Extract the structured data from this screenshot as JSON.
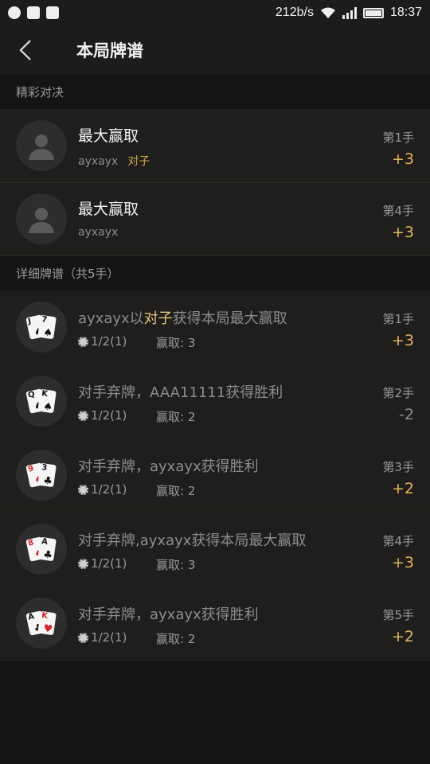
{
  "status_bar": {
    "speed": "212b/s",
    "time": "18:37"
  },
  "header": {
    "title": "本局牌谱"
  },
  "highlights": {
    "section_label": "精彩对决",
    "items": [
      {
        "title": "最大赢取",
        "player": "ayxayx",
        "hand_type": "对子",
        "hand_no": "第1手",
        "score": "+3"
      },
      {
        "title": "最大赢取",
        "player": "ayxayx",
        "hand_type": "",
        "hand_no": "第4手",
        "score": "+3"
      }
    ]
  },
  "details": {
    "section_label": "详细牌谱（共5手）",
    "items": [
      {
        "desc_a": "ayxayx以",
        "desc_hl": "对子",
        "desc_b": "获得本局最大赢取",
        "blinds": "1/2(1)",
        "win": "赢取: 3",
        "hand_no": "第1手",
        "score": "+3",
        "cards": [
          {
            "rank": "J",
            "suit": "♠",
            "red": false
          },
          {
            "rank": "7",
            "suit": "♠",
            "red": false
          }
        ]
      },
      {
        "desc_a": "对手弃牌，AAA11111获得胜利",
        "desc_hl": "",
        "desc_b": "",
        "blinds": "1/2(1)",
        "win": "赢取: 2",
        "hand_no": "第2手",
        "score": "-2",
        "cards": [
          {
            "rank": "Q",
            "suit": "♠",
            "red": false
          },
          {
            "rank": "K",
            "suit": "♠",
            "red": false
          }
        ]
      },
      {
        "desc_a": "对手弃牌，ayxayx获得胜利",
        "desc_hl": "",
        "desc_b": "",
        "blinds": "1/2(1)",
        "win": "赢取: 2",
        "hand_no": "第3手",
        "score": "+2",
        "cards": [
          {
            "rank": "9",
            "suit": "♦",
            "red": true
          },
          {
            "rank": "3",
            "suit": "♣",
            "red": false
          }
        ]
      },
      {
        "desc_a": "对手弃牌,ayxayx获得本局最大赢取",
        "desc_hl": "",
        "desc_b": "",
        "blinds": "1/2(1)",
        "win": "赢取: 3",
        "hand_no": "第4手",
        "score": "+3",
        "cards": [
          {
            "rank": "8",
            "suit": "♦",
            "red": true
          },
          {
            "rank": "A",
            "suit": "♣",
            "red": false
          }
        ]
      },
      {
        "desc_a": "对手弃牌，ayxayx获得胜利",
        "desc_hl": "",
        "desc_b": "",
        "blinds": "1/2(1)",
        "win": "赢取: 2",
        "hand_no": "第5手",
        "score": "+2",
        "cards": [
          {
            "rank": "A",
            "suit": "♣",
            "red": false
          },
          {
            "rank": "K",
            "suit": "♥",
            "red": true
          }
        ]
      }
    ]
  },
  "colors": {
    "accent": "#e3b35b",
    "background": "#141414",
    "row": "#1f1e1c"
  }
}
